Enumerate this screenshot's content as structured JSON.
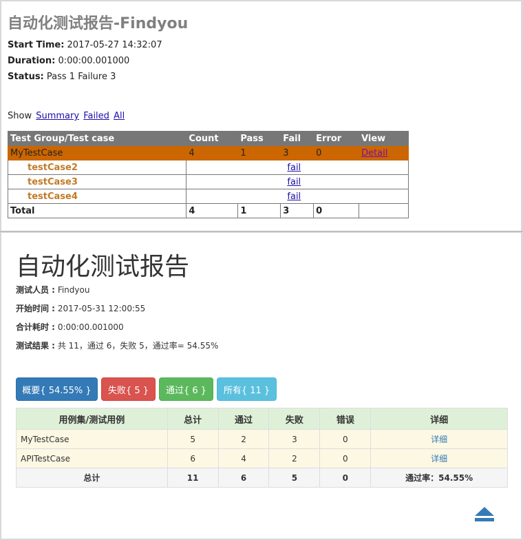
{
  "report1": {
    "title": "自动化测试报告-Findyou",
    "start_label": "Start Time:",
    "start_value": "2017-05-27 14:32:07",
    "duration_label": "Duration:",
    "duration_value": "0:00:00.001000",
    "status_label": "Status:",
    "status_value": "Pass 1 Failure 3",
    "show_label": "Show",
    "show_links": [
      "Summary",
      "Failed",
      "All"
    ],
    "headers": [
      "Test Group/Test case",
      "Count",
      "Pass",
      "Fail",
      "Error",
      "View"
    ],
    "class_row": {
      "name": "MyTestCase",
      "count": "4",
      "pass": "1",
      "fail": "3",
      "error": "0",
      "view": "Detail"
    },
    "cases": [
      {
        "name": "testCase2",
        "result": "fail"
      },
      {
        "name": "testCase3",
        "result": "fail"
      },
      {
        "name": "testCase4",
        "result": "fail"
      }
    ],
    "total_row": {
      "label": "Total",
      "count": "4",
      "pass": "1",
      "fail": "3",
      "error": "0"
    },
    "colors": {
      "header_bg": "#777777",
      "class_bg": "#cc6600",
      "case_text": "#c27a26"
    }
  },
  "report2": {
    "title": "自动化测试报告",
    "tester_label": "测试人员 :",
    "tester_value": "Findyou",
    "start_label": "开始时间 :",
    "start_value": "2017-05-31 12:00:55",
    "duration_label": "合计耗时 :",
    "duration_value": "0:00:00.001000",
    "result_label": "测试结果 :",
    "result_value": "共 11，通过 6，失败 5，通过率= 54.55%",
    "buttons": {
      "summary": "概要{ 54.55% }",
      "failed": "失败{ 5 }",
      "passed": "通过{ 6 }",
      "all": "所有{ 11 }"
    },
    "headers": [
      "用例集/测试用例",
      "总计",
      "通过",
      "失败",
      "错误",
      "详细"
    ],
    "rows": [
      {
        "name": "MyTestCase",
        "total": "5",
        "pass": "2",
        "fail": "3",
        "error": "0",
        "detail": "详细"
      },
      {
        "name": "APITestCase",
        "total": "6",
        "pass": "4",
        "fail": "2",
        "error": "0",
        "detail": "详细"
      }
    ],
    "total_row": {
      "label": "总计",
      "total": "11",
      "pass": "6",
      "fail": "5",
      "error": "0",
      "rate": "通过率：54.55%"
    },
    "colors": {
      "header_bg": "#dff0d8",
      "row_bg": "#fcf8e3",
      "total_bg": "#f5f5f5",
      "link": "#337ab7"
    },
    "back_to_top_icon": "eject-up-icon"
  }
}
